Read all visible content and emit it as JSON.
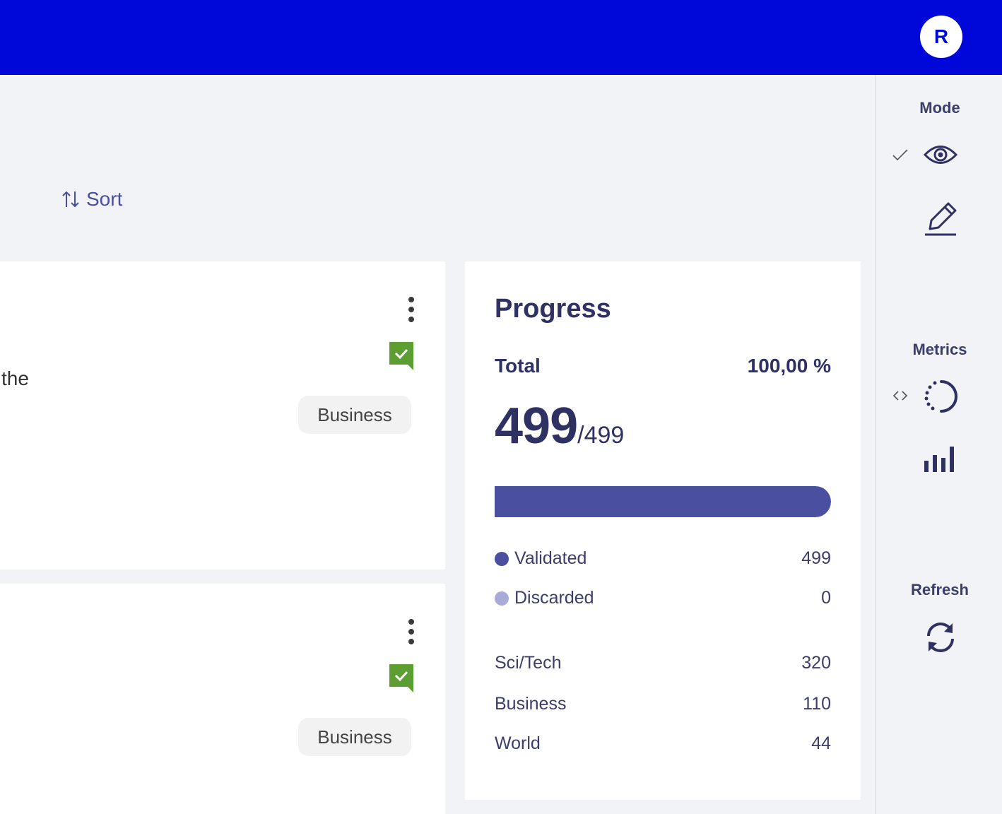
{
  "header": {
    "avatar_initial": "R",
    "brand_color": "#0008d9"
  },
  "toolbar": {
    "sort_label": "Sort"
  },
  "records": [
    {
      "text": "the",
      "label": "Business"
    },
    {
      "text": "",
      "label": "Business"
    }
  ],
  "progress": {
    "title": "Progress",
    "total_label": "Total",
    "total_percent": "100,00 %",
    "count": "499",
    "count_total": "/499",
    "fraction": 1.0,
    "statuses": [
      {
        "label": "Validated",
        "value": "499",
        "color": "#4b4fa0"
      },
      {
        "label": "Discarded",
        "value": "0",
        "color": "#a9aad6"
      }
    ],
    "labels": [
      {
        "label": "Sci/Tech",
        "value": "320"
      },
      {
        "label": "Business",
        "value": "110"
      },
      {
        "label": "World",
        "value": "44"
      }
    ]
  },
  "sidebar": {
    "mode_heading": "Mode",
    "metrics_heading": "Metrics",
    "refresh_heading": "Refresh",
    "mode_items": [
      "eye-icon",
      "pencil-icon"
    ],
    "metrics_items": [
      "progress-circle-icon",
      "bar-chart-icon"
    ]
  }
}
